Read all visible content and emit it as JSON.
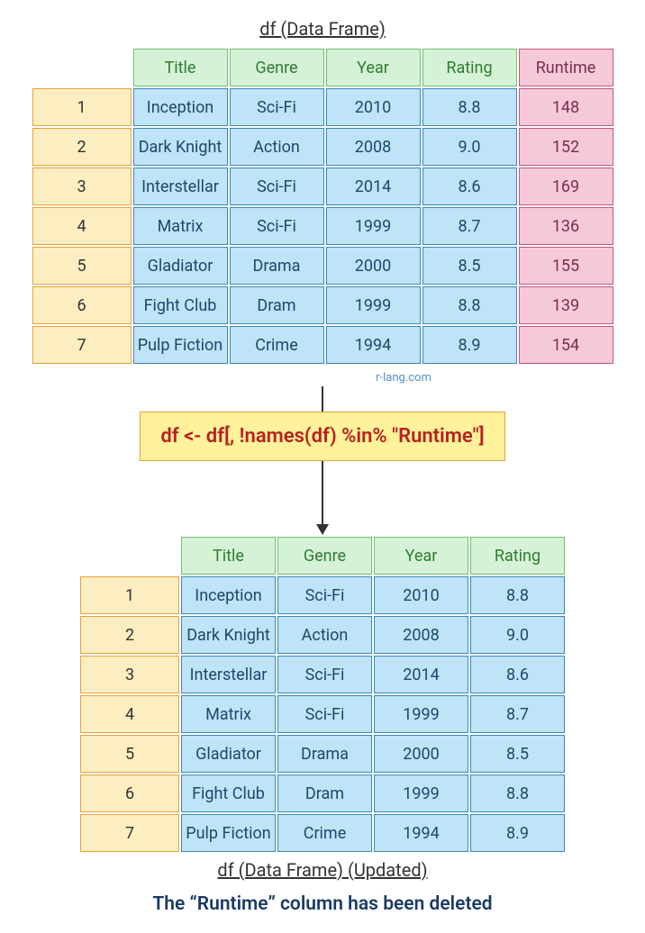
{
  "title_top": "df (Data Frame)",
  "title_bottom": "df (Data Frame) (Updated)",
  "credit": "r-lang.com",
  "code": "df <- df[, !names(df) %in% \"Runtime\"]",
  "caption": "The “Runtime” column has been deleted",
  "table1": {
    "headers": [
      "Title",
      "Genre",
      "Year",
      "Rating",
      "Runtime"
    ],
    "row_indices": [
      "1",
      "2",
      "3",
      "4",
      "5",
      "6",
      "7"
    ],
    "rows": [
      [
        "Inception",
        "Sci-Fi",
        "2010",
        "8.8",
        "148"
      ],
      [
        "Dark Knight",
        "Action",
        "2008",
        "9.0",
        "152"
      ],
      [
        "Interstellar",
        "Sci-Fi",
        "2014",
        "8.6",
        "169"
      ],
      [
        "Matrix",
        "Sci-Fi",
        "1999",
        "8.7",
        "136"
      ],
      [
        "Gladiator",
        "Drama",
        "2000",
        "8.5",
        "155"
      ],
      [
        "Fight Club",
        "Dram",
        "1999",
        "8.8",
        "139"
      ],
      [
        "Pulp Fiction",
        "Crime",
        "1994",
        "8.9",
        "154"
      ]
    ]
  },
  "table2": {
    "headers": [
      "Title",
      "Genre",
      "Year",
      "Rating"
    ],
    "row_indices": [
      "1",
      "2",
      "3",
      "4",
      "5",
      "6",
      "7"
    ],
    "rows": [
      [
        "Inception",
        "Sci-Fi",
        "2010",
        "8.8"
      ],
      [
        "Dark Knight",
        "Action",
        "2008",
        "9.0"
      ],
      [
        "Interstellar",
        "Sci-Fi",
        "2014",
        "8.6"
      ],
      [
        "Matrix",
        "Sci-Fi",
        "1999",
        "8.7"
      ],
      [
        "Gladiator",
        "Drama",
        "2000",
        "8.5"
      ],
      [
        "Fight Club",
        "Dram",
        "1999",
        "8.8"
      ],
      [
        "Pulp Fiction",
        "Crime",
        "1994",
        "8.9"
      ]
    ]
  }
}
